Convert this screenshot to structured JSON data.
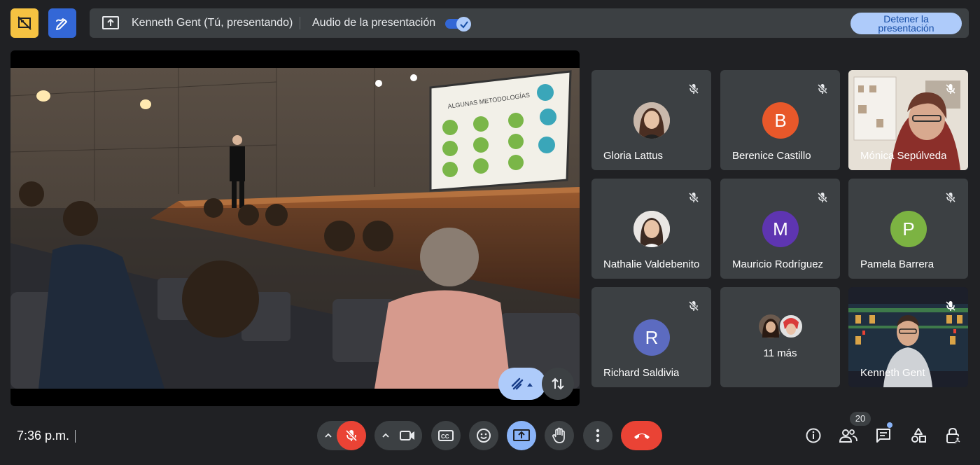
{
  "top_bar": {
    "presenter_text": "Kenneth Gent (Tú, presentando)",
    "audio_label": "Audio de la presentación",
    "audio_enabled": true,
    "stop_button_line1": "Detener la",
    "stop_button_line2": "presentación"
  },
  "stage": {
    "slide_heading": "ALGUNAS METODOLOGÍAS"
  },
  "participants": [
    {
      "name": "Gloria Lattus",
      "type": "photo",
      "muted": true
    },
    {
      "name": "Berenice Castillo",
      "type": "initial",
      "initial": "B",
      "color": "#e8582a",
      "muted": true
    },
    {
      "name": "Mónica Sepúlveda",
      "type": "video",
      "muted": true
    },
    {
      "name": "Nathalie Valdebenito",
      "type": "photo",
      "muted": true
    },
    {
      "name": "Mauricio Rodríguez",
      "type": "initial",
      "initial": "M",
      "color": "#5e35b1",
      "muted": true
    },
    {
      "name": "Pamela Barrera",
      "type": "initial",
      "initial": "P",
      "color": "#7cb342",
      "muted": true
    },
    {
      "name": "Richard Saldivia",
      "type": "initial",
      "initial": "R",
      "color": "#5c6bc0",
      "muted": true
    },
    {
      "name": "11 más",
      "type": "more",
      "muted": false
    },
    {
      "name": "Kenneth Gent",
      "type": "video",
      "muted": true
    }
  ],
  "bottom_bar": {
    "time": "7:36 p.m.",
    "participants_count": "20",
    "buttons": [
      "microphone-off",
      "camera",
      "captions",
      "reactions",
      "present",
      "raise-hand",
      "more-options",
      "leave-call"
    ],
    "right_buttons": [
      "info",
      "people",
      "chat",
      "activities",
      "host-controls"
    ]
  },
  "colors": {
    "background": "#202124",
    "surface": "#3c4043",
    "accent": "#8ab4f8",
    "danger": "#ea4335",
    "warning": "#f6c342"
  }
}
